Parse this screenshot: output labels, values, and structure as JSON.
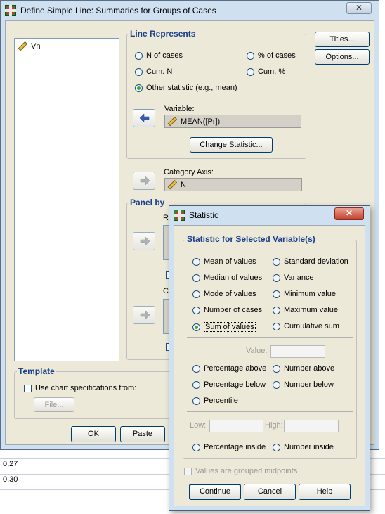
{
  "sheet": {
    "rows": [
      "0,27",
      "0,30"
    ]
  },
  "main_dialog": {
    "title": "Define Simple Line: Summaries for Groups of Cases",
    "variables_list": [
      {
        "name": "Vn",
        "icon": "scale-ruler-icon"
      }
    ],
    "line_represents": {
      "legend": "Line Represents",
      "options": {
        "n_of_cases": "N of cases",
        "pct_of_cases": "% of cases",
        "cum_n": "Cum. N",
        "cum_pct": "Cum. %",
        "other_statistic": "Other statistic (e.g., mean)"
      },
      "selected": "other_statistic",
      "variable_label": "Variable:",
      "variable_value": "MEAN([Pr])",
      "change_statistic": "Change Statistic..."
    },
    "category_axis": {
      "label": "Category Axis:",
      "value": "N"
    },
    "panel_by": {
      "legend": "Panel by",
      "rows_label": "Ro",
      "columns_label": "Co"
    },
    "template": {
      "legend": "Template",
      "checkbox_label": "Use chart specifications from:",
      "file_button": "File..."
    },
    "buttons": {
      "titles": "Titles...",
      "options": "Options...",
      "ok": "OK",
      "paste": "Paste"
    }
  },
  "stat_dialog": {
    "title": "Statistic",
    "section_label": "Statistic for Selected Variable(s)",
    "options_left": [
      "Mean of values",
      "Median of values",
      "Mode of values",
      "Number of cases",
      "Sum of values"
    ],
    "options_right": [
      "Standard deviation",
      "Variance",
      "Minimum value",
      "Maximum value",
      "Cumulative sum"
    ],
    "selected": "Sum of values",
    "value_label": "Value:",
    "percent_left": [
      "Percentage above",
      "Percentage below",
      "Percentile"
    ],
    "percent_right": [
      "Number above",
      "Number below"
    ],
    "low_label": "Low:",
    "high_label": "High:",
    "inside_left": "Percentage inside",
    "inside_right": "Number inside",
    "grouped_midpoints": "Values are grouped midpoints",
    "buttons": {
      "continue": "Continue",
      "cancel": "Cancel",
      "help": "Help"
    }
  },
  "colors": {
    "legend_blue": "#1a3f8a",
    "radio_selected": "#3ca43c",
    "window_frame": "#cfe0f0",
    "dialog_face": "#ece9d8"
  }
}
